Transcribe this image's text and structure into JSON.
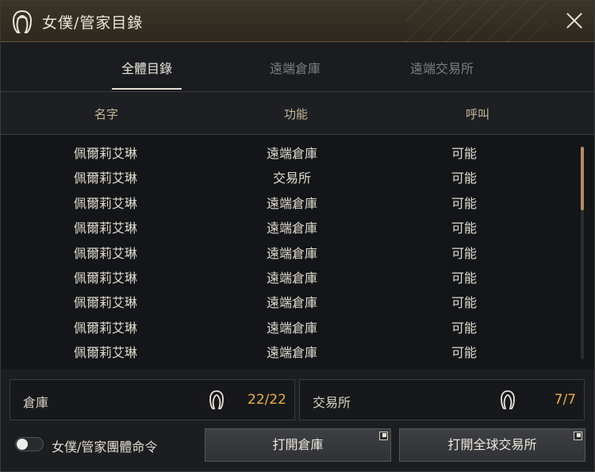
{
  "window": {
    "title": "女僕/管家目錄",
    "close_icon": "close-icon"
  },
  "tabs": [
    {
      "label": "全體目錄",
      "active": true
    },
    {
      "label": "遠端倉庫",
      "active": false
    },
    {
      "label": "遠端交易所",
      "active": false
    }
  ],
  "table": {
    "headers": [
      "名字",
      "功能",
      "呼叫"
    ],
    "rows": [
      {
        "name": "佩爾莉艾琳",
        "function": "遠端倉庫",
        "call": "可能"
      },
      {
        "name": "佩爾莉艾琳",
        "function": "交易所",
        "call": "可能"
      },
      {
        "name": "佩爾莉艾琳",
        "function": "遠端倉庫",
        "call": "可能"
      },
      {
        "name": "佩爾莉艾琳",
        "function": "遠端倉庫",
        "call": "可能"
      },
      {
        "name": "佩爾莉艾琳",
        "function": "遠端倉庫",
        "call": "可能"
      },
      {
        "name": "佩爾莉艾琳",
        "function": "遠端倉庫",
        "call": "可能"
      },
      {
        "name": "佩爾莉艾琳",
        "function": "遠端倉庫",
        "call": "可能"
      },
      {
        "name": "佩爾莉艾琳",
        "function": "遠端倉庫",
        "call": "可能"
      },
      {
        "name": "佩爾莉艾琳",
        "function": "遠端倉庫",
        "call": "可能"
      }
    ]
  },
  "stats": {
    "storage": {
      "label": "倉庫",
      "value": "22/22"
    },
    "market": {
      "label": "交易所",
      "value": "7/7"
    }
  },
  "footer": {
    "toggle_label": "女僕/管家團體命令",
    "toggle_on": false,
    "open_storage": "打開倉庫",
    "open_market": "打開全球交易所"
  },
  "colors": {
    "accent": "#e8b045",
    "scroll_thumb": "#b09062"
  }
}
